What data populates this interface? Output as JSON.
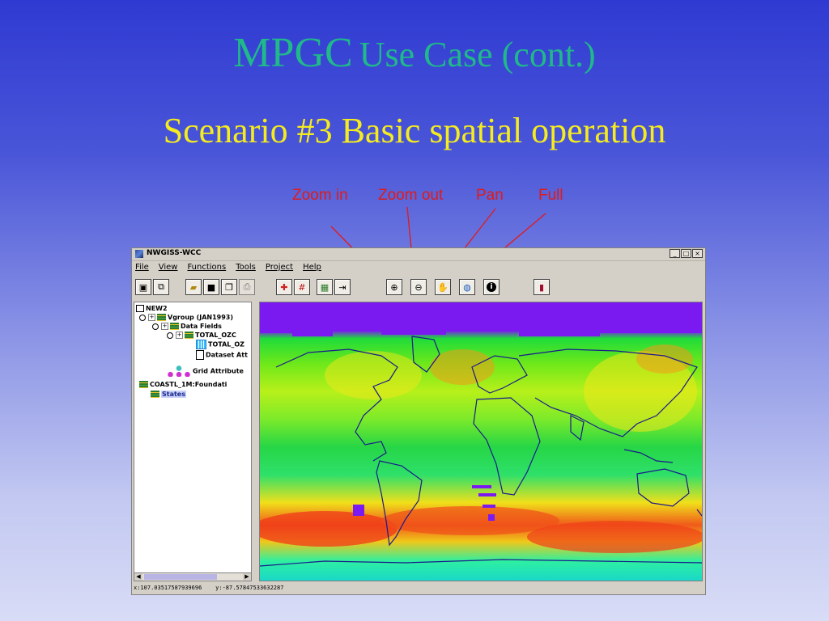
{
  "slide": {
    "title_big": "MPGC",
    "title_small": "Use Case (cont.)",
    "subtitle": "Scenario #3 Basic spatial operation",
    "callouts": {
      "zoom_in": "Zoom in",
      "zoom_out": "Zoom out",
      "pan": "Pan",
      "full": "Full"
    }
  },
  "window": {
    "title": "NWGISS-WCC",
    "controls": {
      "minimize": "_",
      "maximize": "□",
      "close": "×"
    },
    "menu": [
      "File",
      "View",
      "Functions",
      "Tools",
      "Project",
      "Help"
    ],
    "toolbar_icons": [
      "layout-icon",
      "open-layer-icon",
      "open-folder-icon",
      "save-icon",
      "copy-icon",
      "print-icon",
      "add-layer-icon",
      "grid-icon",
      "color-icon",
      "export-icon",
      "zoom-in-icon",
      "zoom-out-icon",
      "pan-hand-icon",
      "full-extent-globe-icon",
      "info-icon",
      "book-icon"
    ],
    "tree": {
      "root": "NEW2",
      "vgroup": "Vgroup (JAN1993)",
      "data_fields": "Data Fields",
      "total_oz": "TOTAL_OZC",
      "total_oz_child": "TOTAL_OZ",
      "dataset_attr": "Dataset Att",
      "grid_attr": "Grid Attribute",
      "coastl": "COASTL_1M:Foundati",
      "states": "States"
    },
    "status": {
      "x": "x:107.03517587939696",
      "y": "y:-87.57847533632287"
    }
  },
  "colors": {
    "title": "#1fb98a",
    "subtitle": "#f5ec1e",
    "callout": "#e01a1a",
    "no_data": "#7b1af0",
    "coastline": "#1a1a8c"
  }
}
